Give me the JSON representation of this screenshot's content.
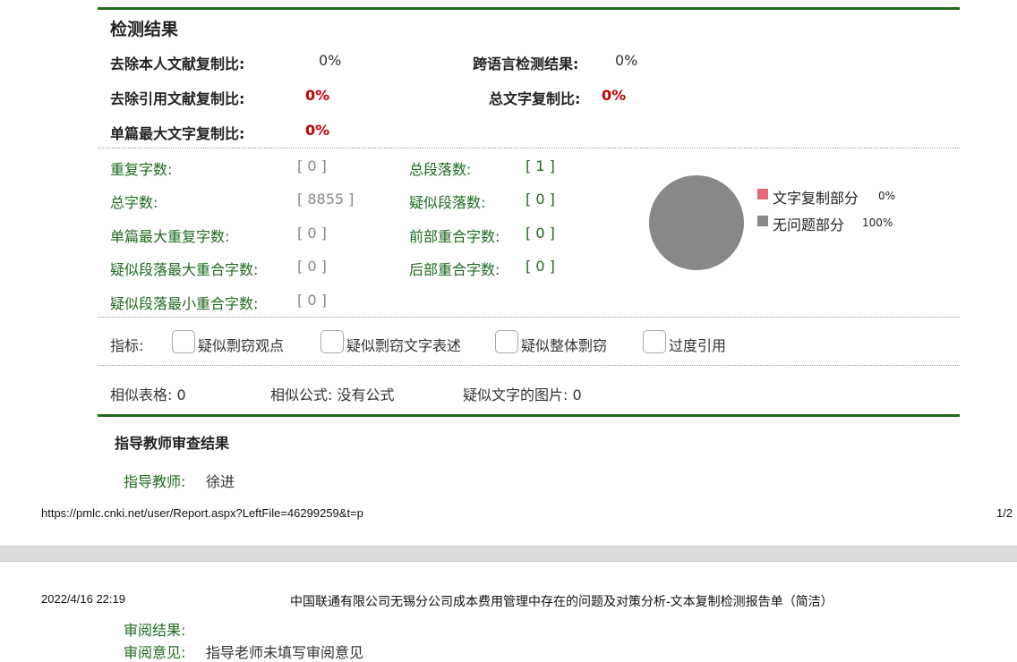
{
  "section": {
    "title": "检测结果"
  },
  "summary": {
    "row1": {
      "label1": "去除本人文献复制比:",
      "value1": "0%",
      "label2": "跨语言检测结果:",
      "value2": "0%"
    },
    "row2": {
      "label1": "去除引用文献复制比:",
      "value1": "0%",
      "label2": "总文字复制比:",
      "value2": "0%"
    },
    "row3": {
      "label1": "单篇最大文字复制比:",
      "value1": "0%"
    }
  },
  "stats": {
    "left": [
      {
        "label": "重复字数:",
        "value": "[ 0 ]"
      },
      {
        "label": "总字数:",
        "value": "[ 8855 ]"
      },
      {
        "label": "单篇最大重复字数:",
        "value": "[ 0 ]"
      },
      {
        "label": "疑似段落最大重合字数:",
        "value": "[ 0 ]"
      },
      {
        "label": "疑似段落最小重合字数:",
        "value": "[ 0 ]"
      }
    ],
    "right": [
      {
        "label": "总段落数:",
        "value": "[ 1 ]"
      },
      {
        "label": "疑似段落数:",
        "value": "[ 0 ]"
      },
      {
        "label": "前部重合字数:",
        "value": "[ 0 ]"
      },
      {
        "label": "后部重合字数:",
        "value": "[ 0 ]"
      }
    ]
  },
  "chart_data": {
    "type": "pie",
    "categories": [
      "文字复制部分",
      "无问题部分"
    ],
    "values": [
      0,
      100
    ],
    "labels": [
      "0%",
      "100%"
    ],
    "colors": [
      "#e8667a",
      "#888888"
    ],
    "legend": "right"
  },
  "indicators": {
    "label": "指标:",
    "items": [
      "疑似剽窃观点",
      "疑似剽窃文字表述",
      "疑似整体剽窃",
      "过度引用"
    ]
  },
  "similar": {
    "table": "相似表格: 0",
    "formula": "相似公式: 没有公式",
    "image": "疑似文字的图片: 0"
  },
  "teacher": {
    "title": "指导教师审查结果",
    "name_label": "指导教师:",
    "name": "徐进"
  },
  "footer1": {
    "url": "https://pmlc.cnki.net/user/Report.aspx?LeftFile=46299259&t=p",
    "page": "1/2"
  },
  "footer2": {
    "datetime": "2022/4/16 22:19",
    "doc_title": "中国联通有限公司无锡分公司成本费用管理中存在的问题及对策分析-文本复制检测报告单（简洁）"
  },
  "review": {
    "result_label": "审阅结果:",
    "opinion_label": "审阅意见:",
    "opinion": "指导老师未填写审阅意见"
  }
}
